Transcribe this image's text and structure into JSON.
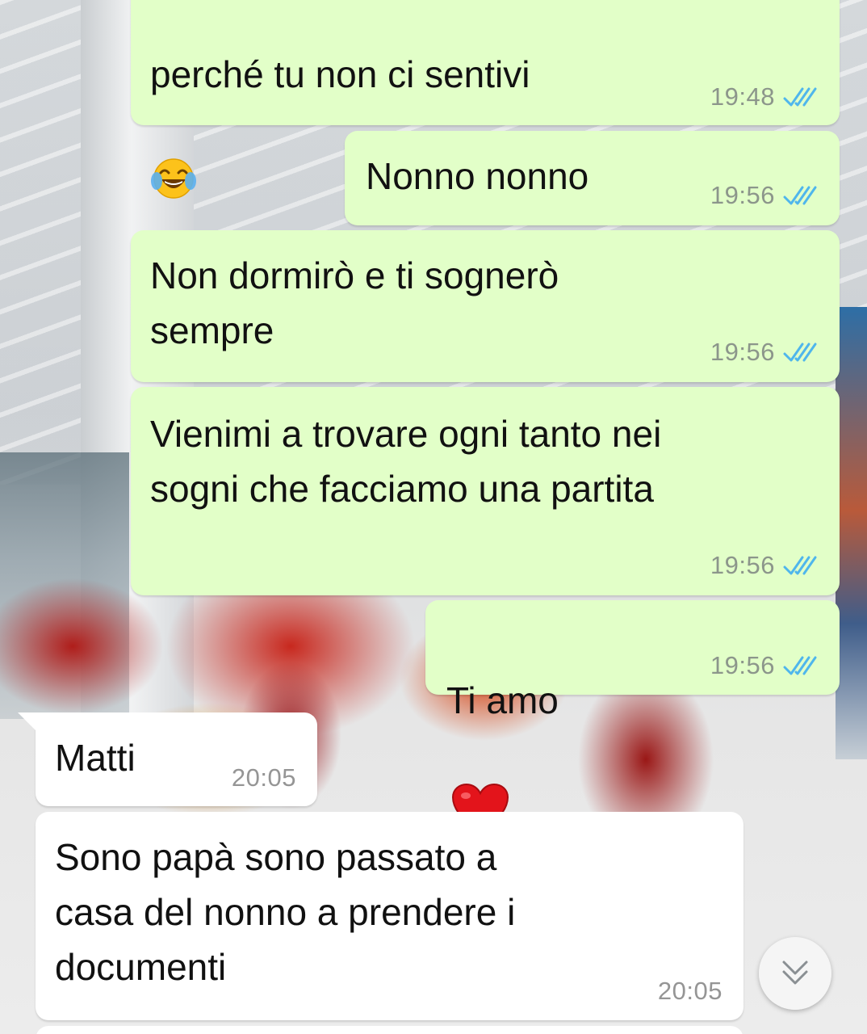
{
  "colors": {
    "outgoing_bubble": "#e2ffc8",
    "incoming_bubble": "#ffffff",
    "read_ticks": "#4fb6ec",
    "timestamp_out": "#8c968b",
    "timestamp_in": "#959595"
  },
  "messages": [
    {
      "direction": "outgoing",
      "text": "perché tu non ci sentivi",
      "emoji": "face-with-tears-of-joy",
      "time": "19:48",
      "status": "read"
    },
    {
      "direction": "outgoing",
      "text": "Nonno nonno",
      "time": "19:56",
      "status": "read"
    },
    {
      "direction": "outgoing",
      "text": "Non dormirò e ti sognerò\nsempre",
      "time": "19:56",
      "status": "read"
    },
    {
      "direction": "outgoing",
      "text": "Vienimi a trovare ogni tanto nei\nsogni che facciamo una partita",
      "time": "19:56",
      "status": "read"
    },
    {
      "direction": "outgoing",
      "text": "Ti amo",
      "emoji": "red-heart",
      "time": "19:56",
      "status": "read"
    },
    {
      "direction": "incoming",
      "text": "Matti",
      "time": "20:05"
    },
    {
      "direction": "incoming",
      "text": "Sono papà sono passato a\ncasa del nonno a prendere i\ndocumenti",
      "time": "20:05"
    }
  ],
  "scroll_button": {
    "icon": "double-chevron-down-icon"
  }
}
